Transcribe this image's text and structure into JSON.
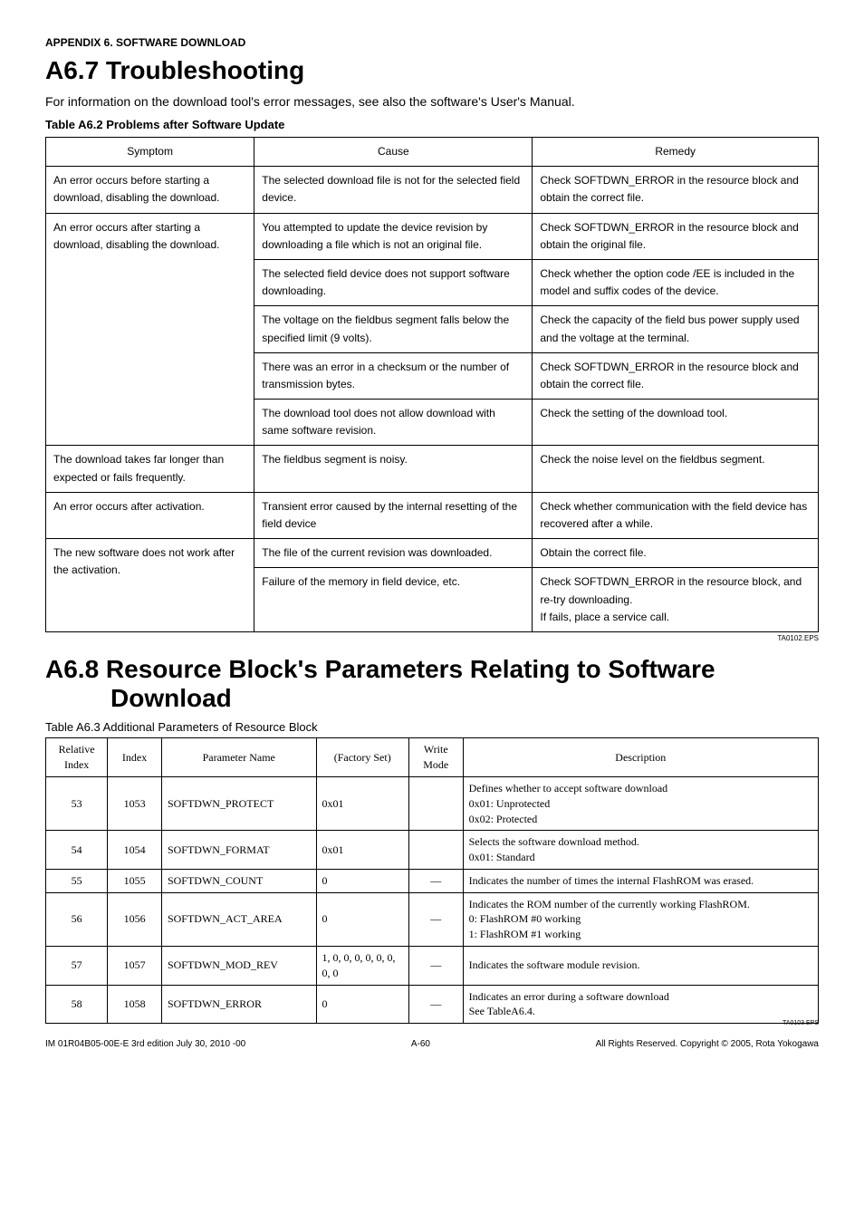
{
  "header": {
    "appendix": "APPENDIX 6. SOFTWARE DOWNLOAD"
  },
  "section1": {
    "title": "A6.7 Troubleshooting",
    "intro": "For information on the download tool's error messages, see also the software's User's Manual.",
    "caption": "Table A6.2   Problems after Software Update",
    "columns": [
      "Symptom",
      "Cause",
      "Remedy"
    ],
    "rows": [
      {
        "symptom": "An error occurs before starting a download, disabling the download.",
        "cause": "The selected download file is not for the selected field device.",
        "remedy": "Check SOFTDWN_ERROR in the resource block and obtain the correct file."
      },
      {
        "symptom": "An error occurs after starting a download, disabling the download.",
        "cause": "You attempted to update the device revision by downloading a file which is not an original file.",
        "remedy": "Check SOFTDWN_ERROR in the resource block and obtain the original file."
      },
      {
        "symptom": "",
        "cause": "The selected field device does not support software downloading.",
        "remedy": "Check whether the option code /EE is included in the model and suffix codes of the device."
      },
      {
        "symptom": "",
        "cause": "The voltage on the fieldbus segment falls below the specified limit (9 volts).",
        "remedy": "Check the capacity of the field bus power supply used and the voltage at the terminal."
      },
      {
        "symptom": "",
        "cause": "There was an error in a checksum or the number of transmission bytes.",
        "remedy": "Check SOFTDWN_ERROR in the resource block and obtain the correct file."
      },
      {
        "symptom": "",
        "cause": "The download tool does not allow download with same software revision.",
        "remedy": "Check the setting of the download tool."
      },
      {
        "symptom": "The download takes far longer than expected or fails frequently.",
        "cause": "The fieldbus segment is noisy.",
        "remedy": "Check the noise level on the fieldbus segment."
      },
      {
        "symptom": "An error occurs after activation.",
        "cause": "Transient error caused by the internal resetting of the field device",
        "remedy": "Check whether communication with the field device has recovered after a while."
      },
      {
        "symptom": "The new software does not work after the activation.",
        "cause": "The file of the current revision was downloaded.",
        "remedy": "Obtain the correct file."
      },
      {
        "symptom": "",
        "cause": "Failure of the memory in field device, etc.",
        "remedy": "Check SOFTDWN_ERROR in the resource block, and re-try downloading.\nIf fails, place a service call."
      }
    ],
    "eps": "TA0102.EPS"
  },
  "section2": {
    "title_line1": "A6.8 Resource Block's Parameters Relating to Software",
    "title_line2": "Download",
    "caption": "Table A6.3   Additional Parameters of Resource Block",
    "columns": [
      "Relative Index",
      "Index",
      "Parameter Name",
      "(Factory Set)",
      "Write Mode",
      "Description"
    ],
    "rows": [
      {
        "rel": "53",
        "idx": "1053",
        "name": "SOFTDWN_PROTECT",
        "fs": "0x01",
        "wm": "",
        "desc": "Defines whether to accept software download\n0x01: Unprotected\n0x02: Protected"
      },
      {
        "rel": "54",
        "idx": "1054",
        "name": "SOFTDWN_FORMAT",
        "fs": "0x01",
        "wm": "",
        "desc": "Selects the software download method.\n0x01: Standard"
      },
      {
        "rel": "55",
        "idx": "1055",
        "name": "SOFTDWN_COUNT",
        "fs": "0",
        "wm": "—",
        "desc": "Indicates the number of times the internal FlashROM was erased."
      },
      {
        "rel": "56",
        "idx": "1056",
        "name": "SOFTDWN_ACT_AREA",
        "fs": "0",
        "wm": "—",
        "desc": "Indicates the ROM number of the currently working FlashROM.\n0: FlashROM #0 working\n1: FlashROM #1 working"
      },
      {
        "rel": "57",
        "idx": "1057",
        "name": "SOFTDWN_MOD_REV",
        "fs": "1, 0, 0, 0, 0, 0, 0, 0, 0",
        "wm": "—",
        "desc": "Indicates the software module revision."
      },
      {
        "rel": "58",
        "idx": "1058",
        "name": "SOFTDWN_ERROR",
        "fs": "0",
        "wm": "—",
        "desc": "Indicates an error during a software download\nSee TableA6.4."
      }
    ],
    "eps": "TA0103.EPS"
  },
  "footer": {
    "left": "IM 01R04B05-00E-E   3rd edition July 30, 2010 -00",
    "mid": "A-60",
    "right": "All Rights Reserved. Copyright © 2005, Rota Yokogawa"
  }
}
